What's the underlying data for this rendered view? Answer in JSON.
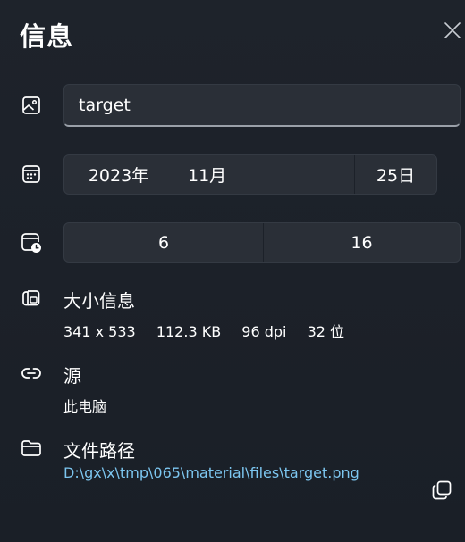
{
  "header": {
    "title": "信息"
  },
  "name_field": {
    "value": "target"
  },
  "date": {
    "year": "2023年",
    "month": "11月",
    "day": "25日"
  },
  "time": {
    "hour": "6",
    "minute": "16"
  },
  "size_info": {
    "label": "大小信息",
    "dimensions": "341 x 533",
    "file_size": "112.3 KB",
    "dpi": "96 dpi",
    "bit_depth": "32 位"
  },
  "source": {
    "label": "源",
    "value": "此电脑"
  },
  "file_path": {
    "label": "文件路径",
    "value": "D:\\gx\\x\\tmp\\065\\material\\files\\target.png"
  },
  "icons": {
    "close": "close-icon",
    "image": "image-icon",
    "calendar": "calendar-icon",
    "calendar_clock": "calendar-clock-icon",
    "image_size": "image-size-icon",
    "link": "link-icon",
    "folder": "folder-icon",
    "copy": "copy-icon"
  },
  "colors": {
    "background": "#1c2129",
    "field_background": "#2a2f37",
    "link": "#7cc6f0",
    "text": "#ffffff"
  }
}
